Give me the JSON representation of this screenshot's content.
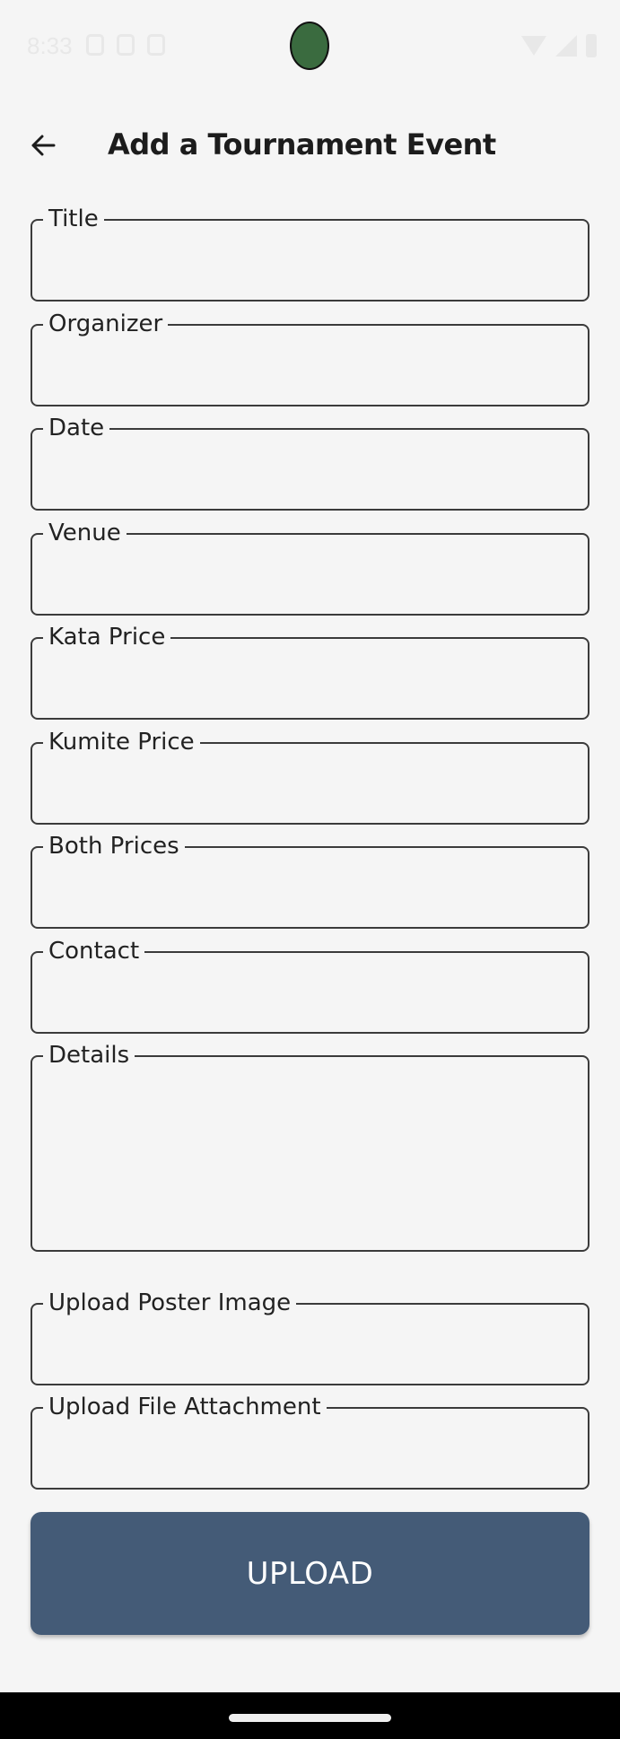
{
  "status_bar": {
    "time": "8:33"
  },
  "app_bar": {
    "title": "Add a Tournament Event"
  },
  "fields": [
    {
      "label": "Title",
      "value": ""
    },
    {
      "label": "Organizer",
      "value": ""
    },
    {
      "label": "Date",
      "value": ""
    },
    {
      "label": "Venue",
      "value": ""
    },
    {
      "label": "Kata Price",
      "value": ""
    },
    {
      "label": "Kumite Price",
      "value": ""
    },
    {
      "label": "Both Prices",
      "value": ""
    },
    {
      "label": "Contact",
      "value": ""
    },
    {
      "label": "Details",
      "value": ""
    },
    {
      "label": "Upload Poster Image",
      "value": ""
    },
    {
      "label": "Upload File Attachment",
      "value": ""
    }
  ],
  "upload_button": {
    "label": "UPLOAD"
  },
  "colors": {
    "background": "#f5f5f5",
    "button": "#445b77",
    "border": "#3b3b3b",
    "nav_bar": "#000000"
  },
  "icons": {
    "back": "arrow-left-icon",
    "wifi": "wifi-icon",
    "signal": "cellular-signal-icon",
    "battery": "battery-icon"
  }
}
